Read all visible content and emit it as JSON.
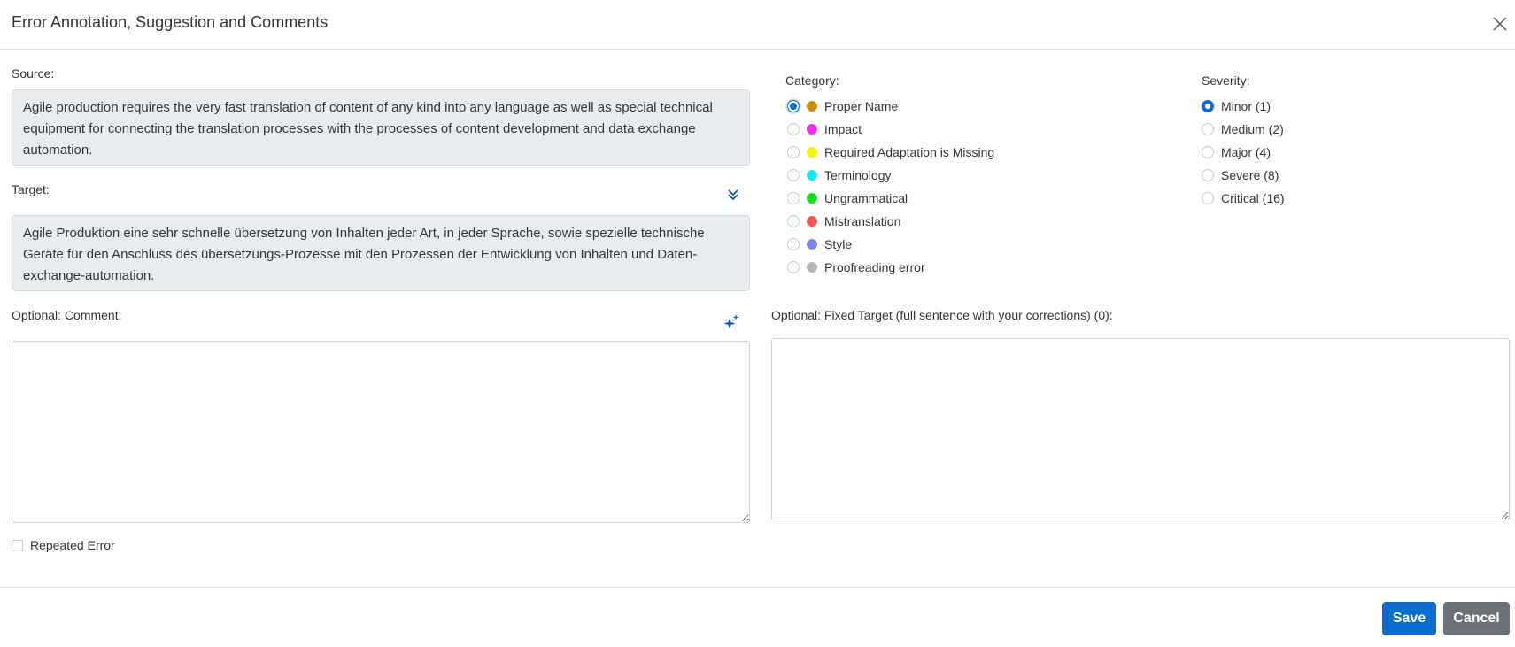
{
  "dialog": {
    "title": "Error Annotation, Suggestion and Comments"
  },
  "source": {
    "label": "Source:",
    "text": "Agile production requires the very fast translation of content of any kind into any language as well as special technical equipment for connecting the translation processes with the processes of content development and data exchange automation."
  },
  "target": {
    "label": "Target:",
    "text": "Agile Produktion eine sehr schnelle übersetzung von Inhalten jeder Art, in jeder Sprache, sowie spezielle technische Geräte für den Anschluss des übersetzungs-Prozesse mit den Prozessen der Entwicklung von Inhalten und Daten-exchange-automation."
  },
  "comment": {
    "label": "Optional: Comment:",
    "value": ""
  },
  "fixed_target": {
    "label": "Optional: Fixed Target (full sentence with your corrections) (0):",
    "value": ""
  },
  "category": {
    "label": "Category:",
    "options": [
      {
        "label": "Proper Name",
        "color": "#c58f00",
        "selected": true
      },
      {
        "label": "Impact",
        "color": "#ef2fe6",
        "selected": false
      },
      {
        "label": "Required Adaptation is Missing",
        "color": "#f5f500",
        "selected": false
      },
      {
        "label": "Terminology",
        "color": "#16e8f0",
        "selected": false
      },
      {
        "label": "Ungrammatical",
        "color": "#17e01a",
        "selected": false
      },
      {
        "label": "Mistranslation",
        "color": "#ef5a55",
        "selected": false
      },
      {
        "label": "Style",
        "color": "#7b86ec",
        "selected": false
      },
      {
        "label": "Proofreading error",
        "color": "#b5b5b5",
        "selected": false
      }
    ]
  },
  "severity": {
    "label": "Severity:",
    "options": [
      {
        "label": "Minor (1)",
        "selected": true
      },
      {
        "label": "Medium (2)",
        "selected": false
      },
      {
        "label": "Major (4)",
        "selected": false
      },
      {
        "label": "Severe (8)",
        "selected": false
      },
      {
        "label": "Critical (16)",
        "selected": false
      }
    ]
  },
  "repeated_error": {
    "label": "Repeated Error",
    "checked": false
  },
  "footer": {
    "save_label": "Save",
    "cancel_label": "Cancel"
  },
  "colors": {
    "accent": "#0a6ed1",
    "cancel": "#6a7178",
    "field_bg": "#e9ecef"
  }
}
